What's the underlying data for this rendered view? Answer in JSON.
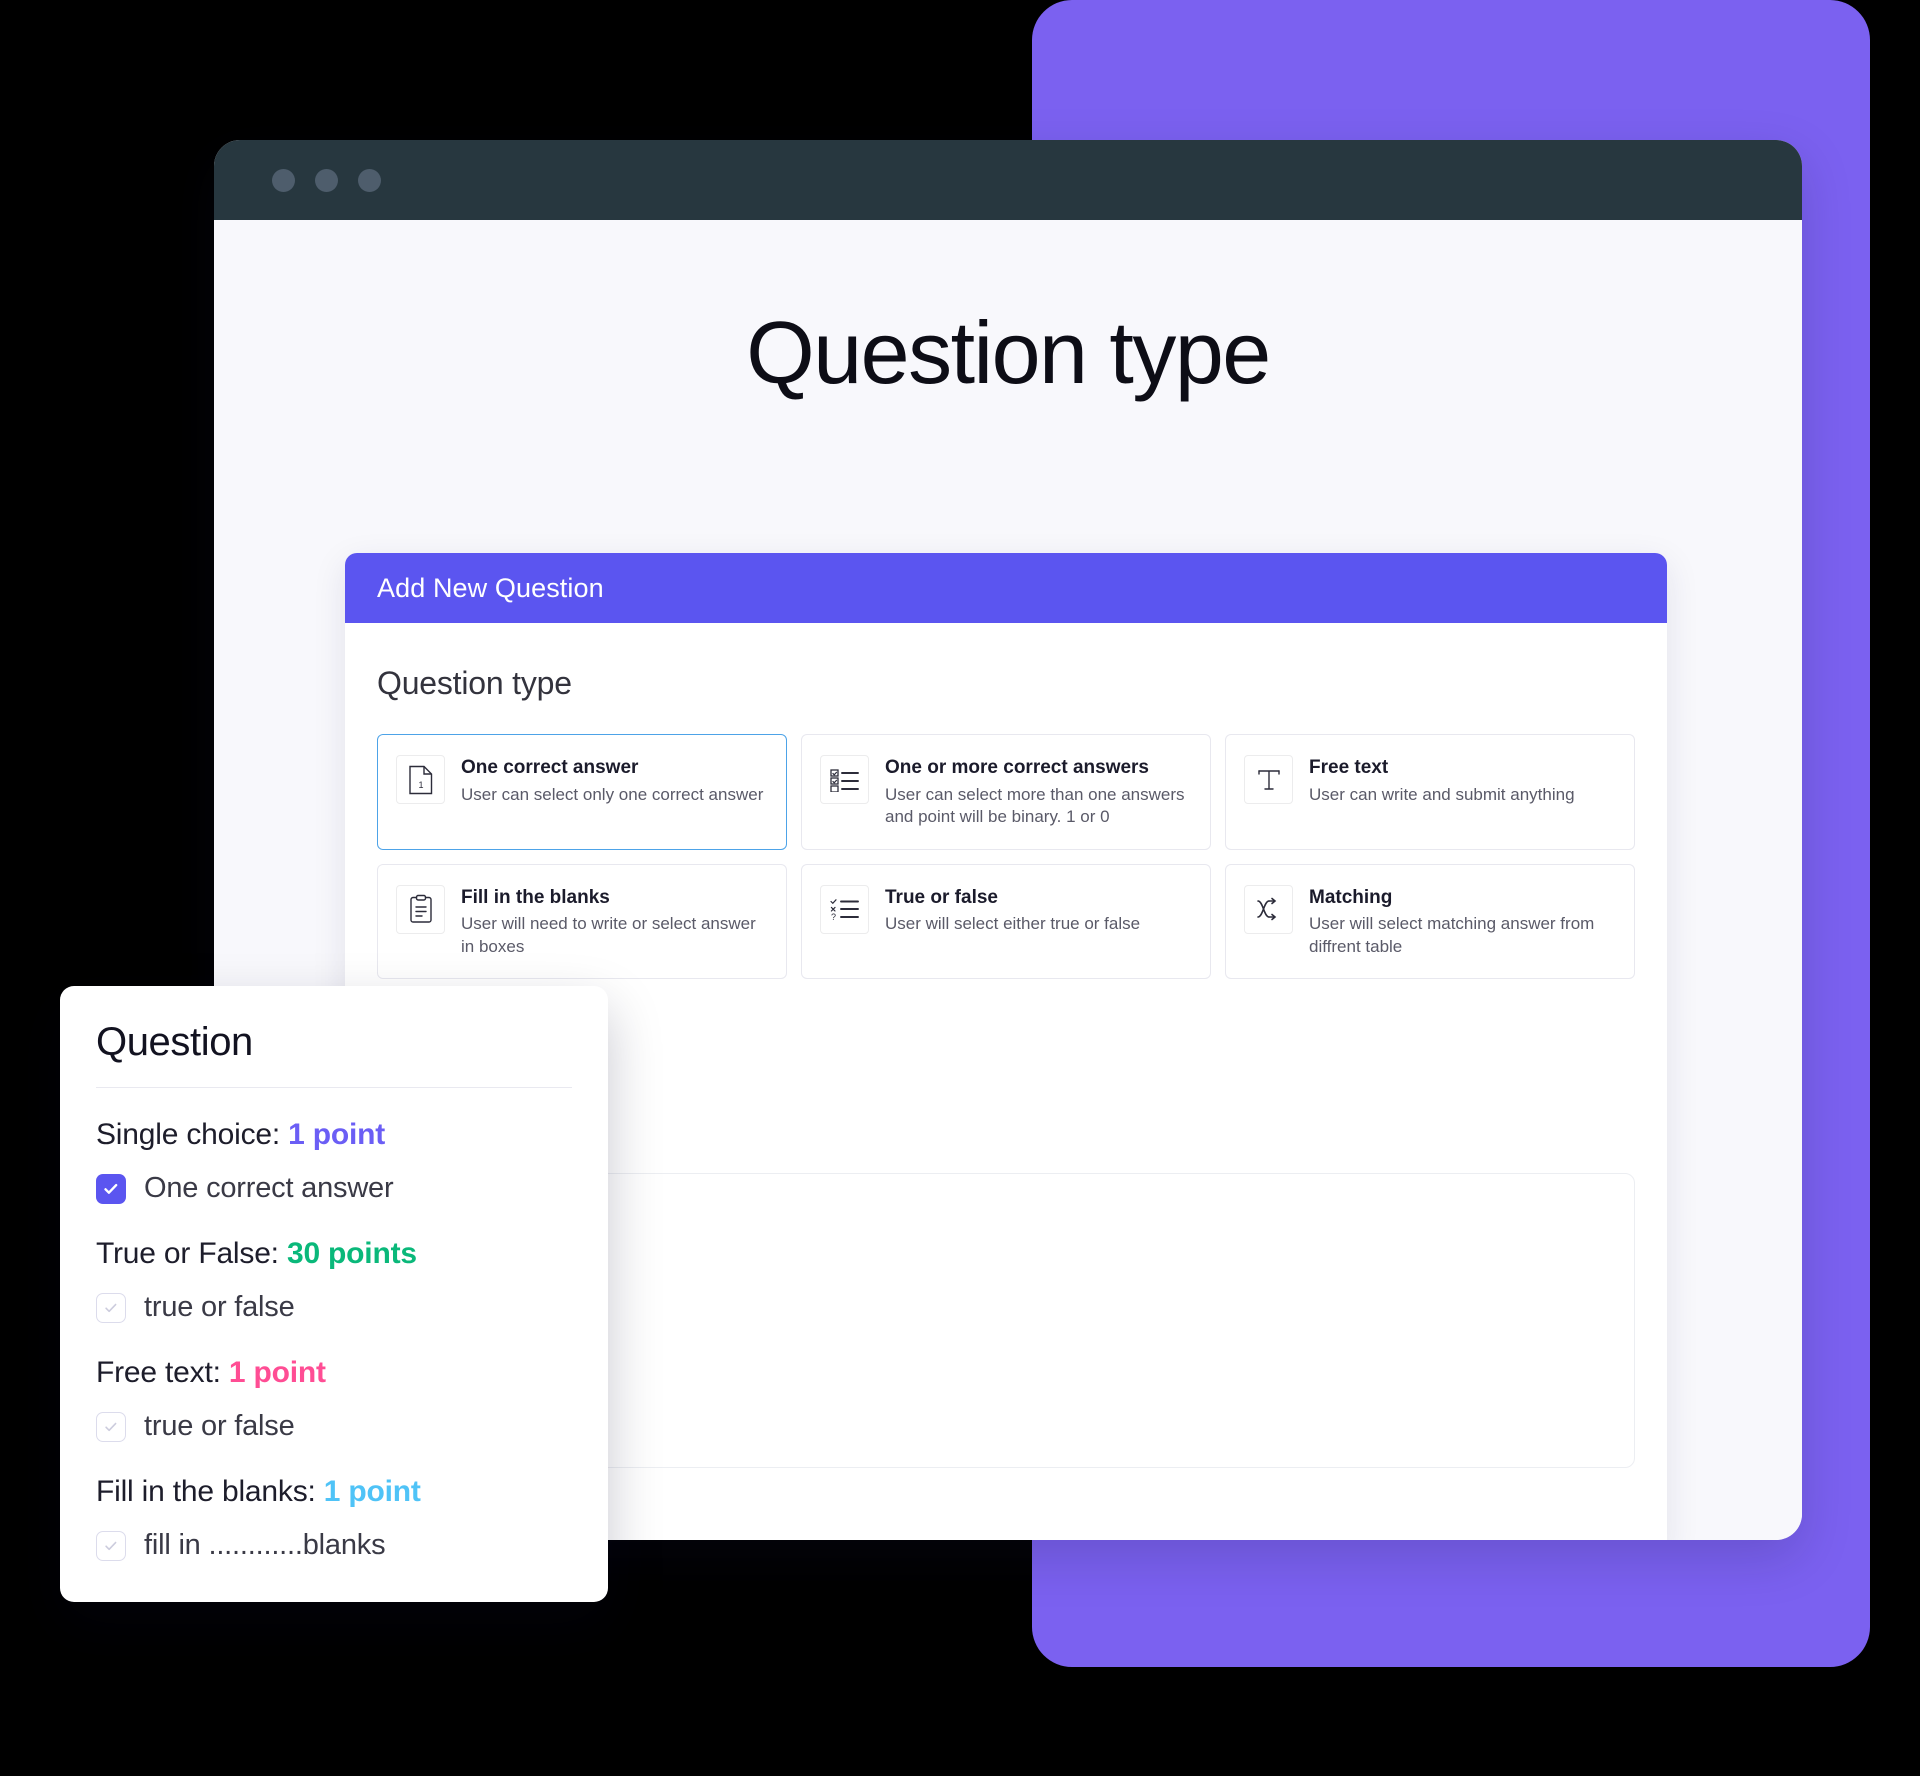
{
  "colors": {
    "backdrop_purple": "#7b61f0",
    "dialog_header_purple": "#5b55f0",
    "titlebar_dark": "#27373f",
    "selected_card_border": "#4da3e8",
    "point_purple": "#6b5ef5",
    "point_green": "#0ab87a",
    "point_pink": "#ff4d94",
    "point_blue": "#4fc3f7"
  },
  "browser": {
    "dots": [
      "window-dot-1",
      "window-dot-2",
      "window-dot-3"
    ]
  },
  "page": {
    "title": "Question type"
  },
  "dialog": {
    "header_title": "Add New Question",
    "section_title": "Question type",
    "types": [
      {
        "icon": "document-one-icon",
        "name": "One correct answer",
        "desc": "User can select only one correct answer",
        "selected": true
      },
      {
        "icon": "checklist-icon",
        "name": "One or more correct answers",
        "desc": "User can select more than one answers and point will be binary. 1 or 0",
        "selected": false
      },
      {
        "icon": "text-format-icon",
        "name": "Free text",
        "desc": "User can write and submit anything",
        "selected": false
      },
      {
        "icon": "clipboard-icon",
        "name": "Fill in the blanks",
        "desc": "User will need to write or select answer in boxes",
        "selected": false
      },
      {
        "icon": "true-false-list-icon",
        "name": "True or false",
        "desc": "User will select either true or false",
        "selected": false
      },
      {
        "icon": "shuffle-icon",
        "name": "Matching",
        "desc": "User will select matching answer from diffrent table",
        "selected": false
      }
    ],
    "editor": {
      "placeholder": "rich text"
    }
  },
  "overlay": {
    "title": "Question",
    "groups": [
      {
        "label": "Single choice: ",
        "points": "1 point",
        "points_color": "#6b5ef5",
        "option_label": "One correct answer",
        "checked": true
      },
      {
        "label": "True or False: ",
        "points": "30 points",
        "points_color": "#0ab87a",
        "option_label": "true or false",
        "checked": false
      },
      {
        "label": "Free text: ",
        "points": "1 point",
        "points_color": "#ff4d94",
        "option_label": "true or false",
        "checked": false
      },
      {
        "label": "Fill in the blanks: ",
        "points": "1 point",
        "points_color": "#4fc3f7",
        "option_label": "fill in ............blanks",
        "checked": false
      }
    ]
  }
}
